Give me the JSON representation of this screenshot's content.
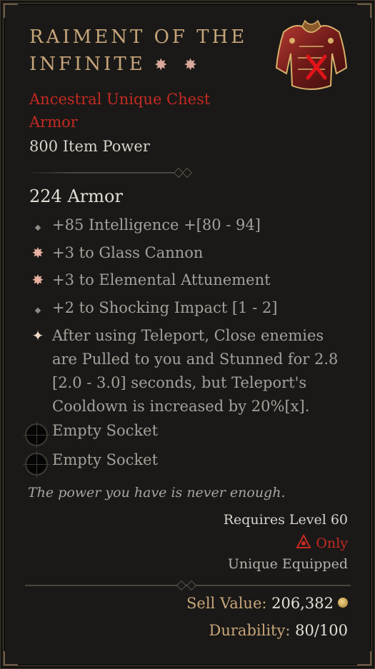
{
  "item": {
    "name": "Raiment of the Infinite",
    "name_glyphs": "✸ ✸",
    "type": "Ancestral Unique Chest Armor",
    "item_power": "800 Item Power",
    "armor": "224 Armor",
    "image_icon": "chest-armor-icon",
    "unusable_mark": "red-x-icon"
  },
  "affixes": [
    {
      "icon": "diamond-bullet-icon",
      "text": "+85 Intelligence +[80 - 94]"
    },
    {
      "icon": "greater-affix-star-icon",
      "text": "+3 to Glass Cannon"
    },
    {
      "icon": "greater-affix-star-icon",
      "text": "+3 to Elemental Attunement"
    },
    {
      "icon": "diamond-bullet-icon",
      "text": "+2 to Shocking Impact [1 - 2]"
    },
    {
      "icon": "unique-power-icon",
      "text": "After using Teleport, Close enemies are Pulled to you and Stunned for 2.8 [2.0 - 3.0] seconds, but Teleport's Cooldown is increased by 20%[x]."
    }
  ],
  "sockets": [
    {
      "label": "Empty Socket"
    },
    {
      "label": "Empty Socket"
    }
  ],
  "flavor_text": "The power you have is never enough.",
  "requirements": {
    "level": "Requires Level 60",
    "class_only": "Only",
    "class_icon": "sorcerer-class-icon",
    "unique_equipped": "Unique Equipped"
  },
  "footer": {
    "sell_label": "Sell Value:",
    "sell_value": "206,382",
    "coin_icon": "gold-coin-icon",
    "durability_label": "Durability:",
    "durability_value": "80/100"
  },
  "colors": {
    "title": "#c7a57a",
    "unique_type": "#c52a22",
    "affix_text": "#a5a09a",
    "background": "#1a1917"
  }
}
